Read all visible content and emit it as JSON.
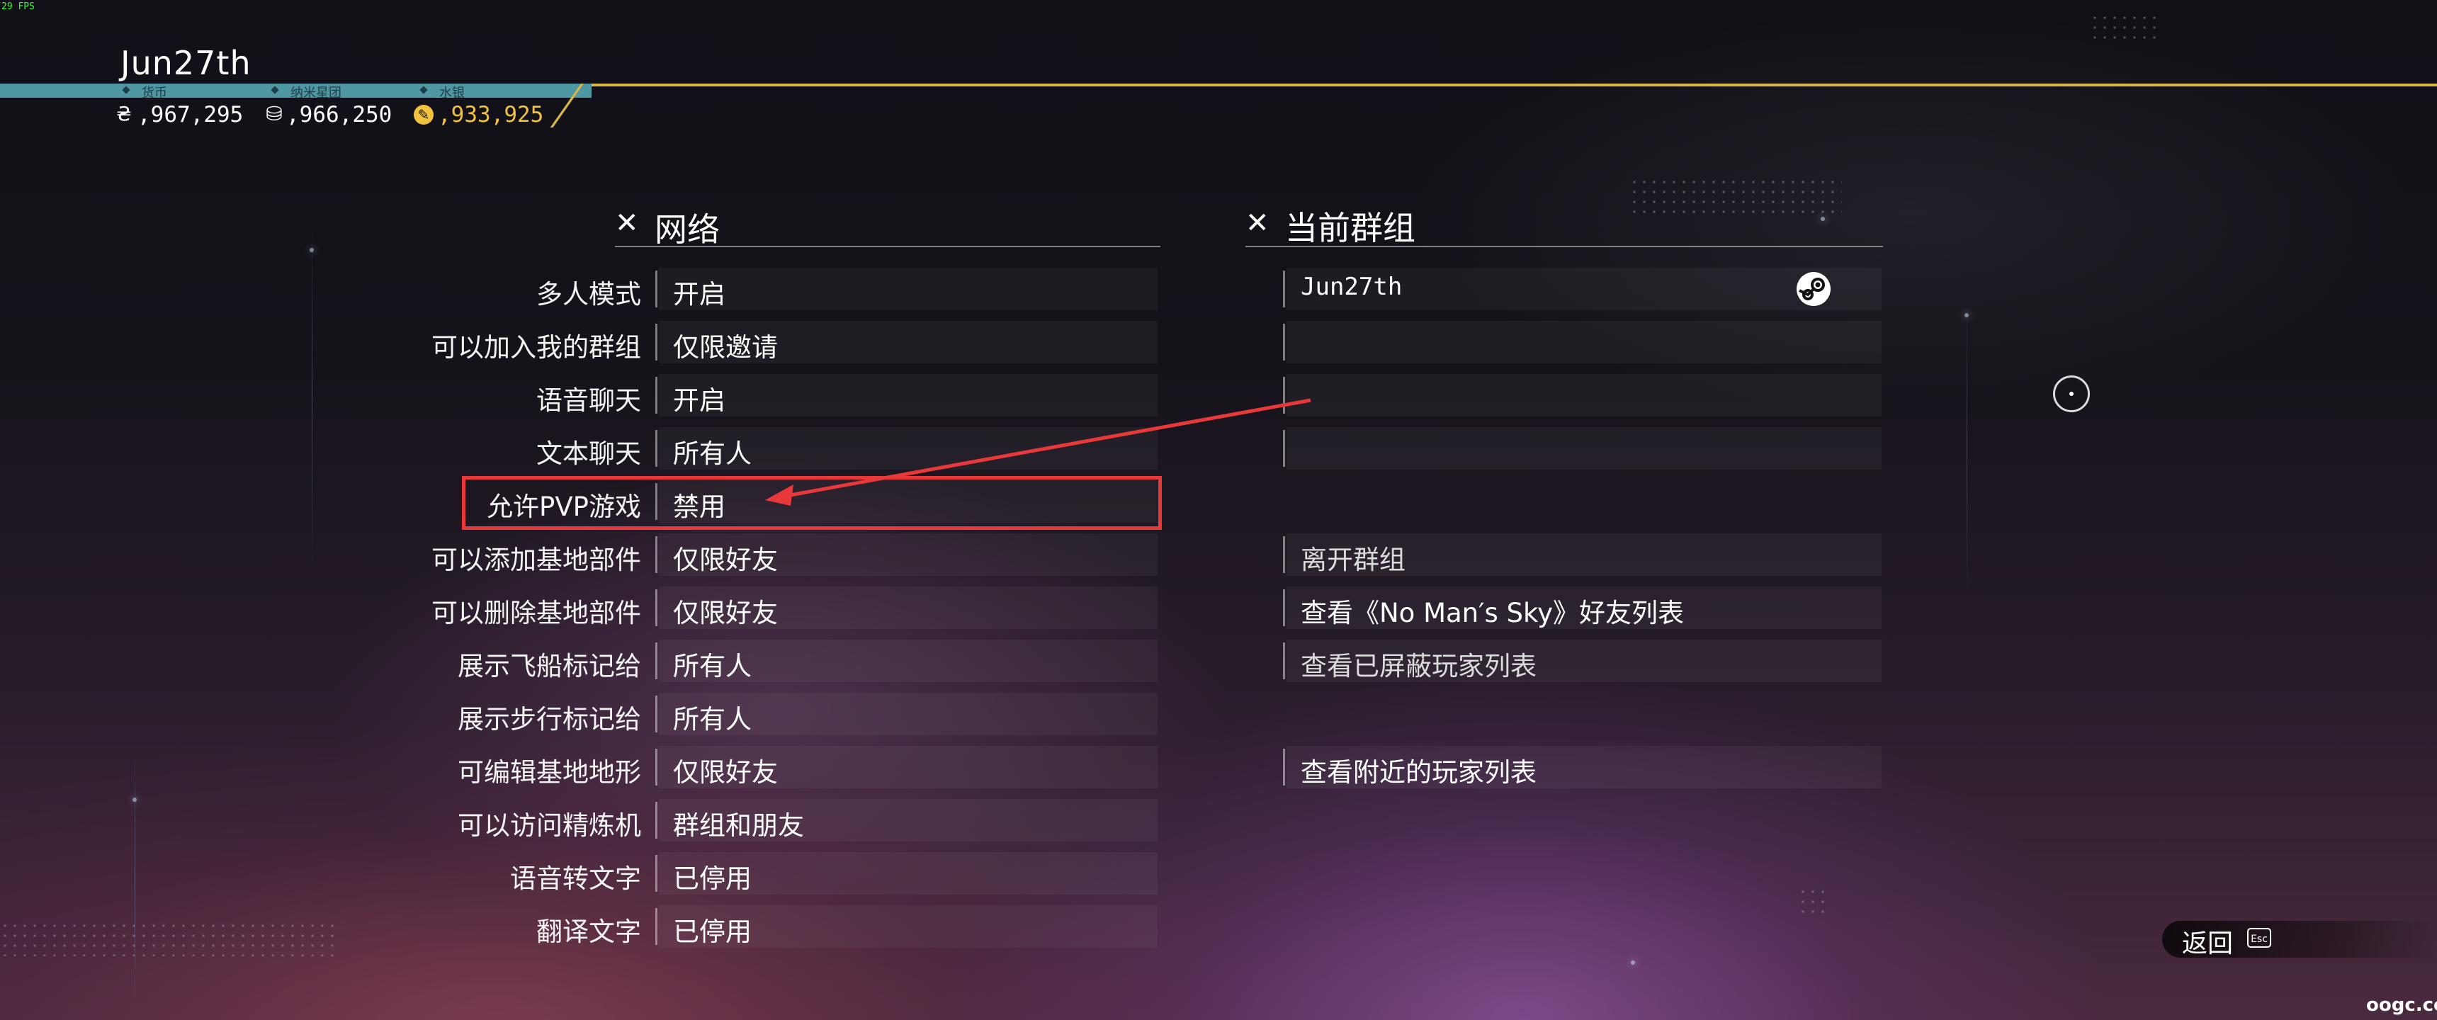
{
  "fps_counter": "29 FPS",
  "header": {
    "profile_name": "Jun27th",
    "currencies": [
      {
        "label": "货币",
        "icon": "units-icon",
        "value": ",967,295"
      },
      {
        "label": "纳米星团",
        "icon": "nanites-icon",
        "value": ",966,250"
      },
      {
        "label": "水银",
        "icon": "quicksilver-icon",
        "value": ",933,925"
      }
    ]
  },
  "network": {
    "title": "网络",
    "rows": [
      {
        "label": "多人模式",
        "value": "开启"
      },
      {
        "label": "可以加入我的群组",
        "value": "仅限邀请"
      },
      {
        "label": "语音聊天",
        "value": "开启"
      },
      {
        "label": "文本聊天",
        "value": "所有人"
      },
      {
        "label": "允许PVP游戏",
        "value": "禁用"
      },
      {
        "label": "可以添加基地部件",
        "value": "仅限好友"
      },
      {
        "label": "可以删除基地部件",
        "value": "仅限好友"
      },
      {
        "label": "展示飞船标记给",
        "value": "所有人"
      },
      {
        "label": "展示步行标记给",
        "value": "所有人"
      },
      {
        "label": "可编辑基地地形",
        "value": "仅限好友"
      },
      {
        "label": "可以访问精炼机",
        "value": "群组和朋友"
      },
      {
        "label": "语音转文字",
        "value": "已停用"
      },
      {
        "label": "翻译文字",
        "value": "已停用"
      }
    ]
  },
  "current_group": {
    "title": "当前群组",
    "member": "Jun27th",
    "actions": [
      "离开群组",
      "查看《No Man′s Sky》好友列表",
      "查看已屏蔽玩家列表",
      "查看附近的玩家列表"
    ]
  },
  "footer": {
    "back_label": "返回",
    "back_key": "Esc"
  },
  "watermark": "oogc.cc",
  "colors": {
    "highlight_border": "#e8383a",
    "arrow": "#e8383a",
    "gold_accent": "#d8b54a",
    "teal_bar": "#4f97a2",
    "quicksilver_text": "#f2c23e"
  }
}
